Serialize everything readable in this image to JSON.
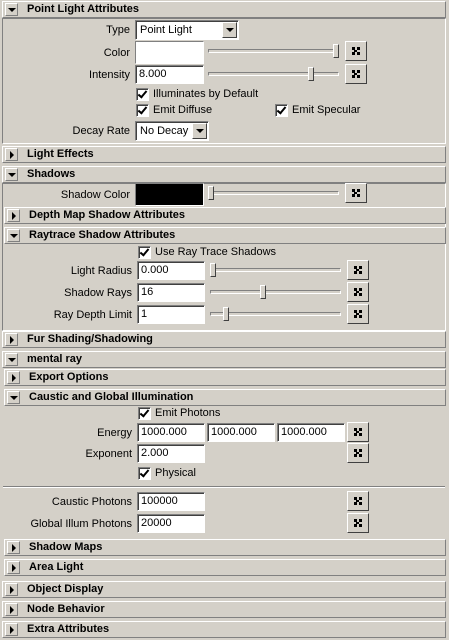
{
  "sections": {
    "point_light": "Point Light Attributes",
    "light_effects": "Light Effects",
    "shadows": "Shadows",
    "depth_map": "Depth Map Shadow Attributes",
    "raytrace": "Raytrace Shadow Attributes",
    "fur": "Fur Shading/Shadowing",
    "mental_ray": "mental ray",
    "export": "Export Options",
    "caustic": "Caustic and Global Illumination",
    "shadow_maps": "Shadow Maps",
    "area_light": "Area Light",
    "object_display": "Object Display",
    "node_behavior": "Node Behavior",
    "extra": "Extra Attributes"
  },
  "point_light": {
    "type_label": "Type",
    "type_value": "Point Light",
    "color_label": "Color",
    "color_value": "#ffffff",
    "color_slider_level": 1.0,
    "intensity_label": "Intensity",
    "intensity_value": "8.000",
    "intensity_slider_level": 0.8,
    "illum_default_label": "Illuminates by Default",
    "illum_default_checked": true,
    "emit_diffuse_label": "Emit Diffuse",
    "emit_diffuse_checked": true,
    "emit_specular_label": "Emit Specular",
    "emit_specular_checked": true,
    "decay_label": "Decay Rate",
    "decay_value": "No Decay"
  },
  "shadows": {
    "color_label": "Shadow Color",
    "color_value": "#000000",
    "color_slider_level": 0.0
  },
  "raytrace": {
    "use_label": "Use Ray Trace Shadows",
    "use_checked": true,
    "radius_label": "Light Radius",
    "radius_value": "0.000",
    "radius_slider_level": 0.0,
    "rays_label": "Shadow Rays",
    "rays_value": "16",
    "rays_slider_level": 0.4,
    "depth_label": "Ray Depth Limit",
    "depth_value": "1",
    "depth_slider_level": 0.1
  },
  "caustic": {
    "emit_label": "Emit Photons",
    "emit_checked": true,
    "energy_label": "Energy",
    "energy_r": "1000.000",
    "energy_g": "1000.000",
    "energy_b": "1000.000",
    "exponent_label": "Exponent",
    "exponent_value": "2.000",
    "physical_label": "Physical",
    "physical_checked": true,
    "caustic_photons_label": "Caustic Photons",
    "caustic_photons_value": "100000",
    "gi_photons_label": "Global Illum Photons",
    "gi_photons_value": "20000"
  }
}
